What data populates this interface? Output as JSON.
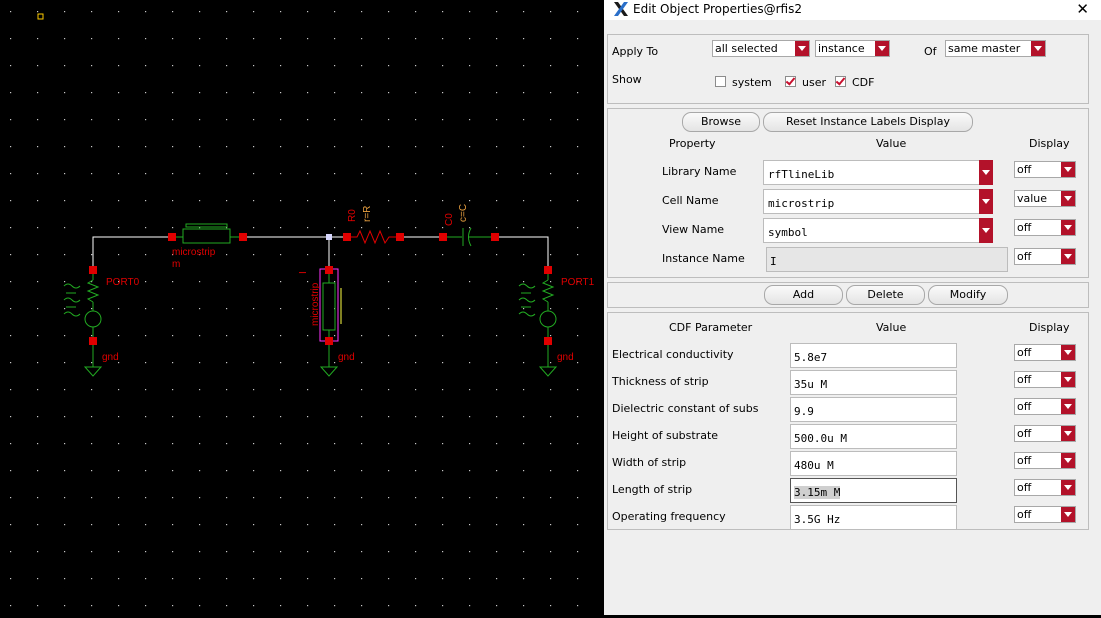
{
  "dialog": {
    "title": "Edit Object Properties@rfis2",
    "apply_to_label": "Apply To",
    "apply_scope": "all selected",
    "apply_type": "instance",
    "of_label": "Of",
    "of_value": "same master",
    "show_label": "Show",
    "show": [
      {
        "label": "system",
        "checked": false
      },
      {
        "label": "user",
        "checked": true
      },
      {
        "label": "CDF",
        "checked": true
      }
    ],
    "browse_button": "Browse",
    "reset_button": "Reset Instance Labels Display",
    "col_property": "Property",
    "col_value": "Value",
    "col_display": "Display",
    "properties": [
      {
        "label": "Library Name",
        "value": "rfTlineLib",
        "display": "off"
      },
      {
        "label": "Cell Name",
        "value": "microstrip",
        "display": "value"
      },
      {
        "label": "View Name",
        "value": "symbol",
        "display": "off"
      },
      {
        "label": "Instance Name",
        "value": "I",
        "display": "off"
      }
    ],
    "add_button": "Add",
    "delete_button": "Delete",
    "modify_button": "Modify",
    "cdf_col_param": "CDF Parameter",
    "cdf_col_value": "Value",
    "cdf_col_display": "Display",
    "cdf": [
      {
        "label": "Electrical conductivity",
        "value": "5.8e7",
        "display": "off"
      },
      {
        "label": "Thickness of strip",
        "value": "35u M",
        "display": "off"
      },
      {
        "label": "Dielectric constant of subs",
        "value": "9.9",
        "display": "off"
      },
      {
        "label": "Height of substrate",
        "value": "500.0u M",
        "display": "off"
      },
      {
        "label": "Width of strip",
        "value": "480u M",
        "display": "off"
      },
      {
        "label": "Length of  strip",
        "value": "3.15m M",
        "display": "off"
      },
      {
        "label": "Operating frequency",
        "value": "3.5G Hz",
        "display": "off"
      }
    ]
  },
  "schematic": {
    "labels": {
      "ms_top": "microstrip",
      "ms_top_inst": "m",
      "ms_vert": "microstrip",
      "ms_vert_inst": "I",
      "port0": "PORT0",
      "port1": "PORT1",
      "gnd_left": "gnd",
      "gnd_mid": "gnd",
      "gnd_right": "gnd",
      "res_name": "R0",
      "res_val": "r=R",
      "cap_name": "C0",
      "cap_val": "c=C"
    },
    "colors": {
      "wire": "#ffffff",
      "pin": "#e00000",
      "symbol": "#22aa22",
      "label": "#e00000",
      "highlight": "#ff33ff"
    }
  },
  "icons": [
    "x-logo-icon",
    "close-icon",
    "dropdown-arrow-icon",
    "checkbox-icon"
  ]
}
